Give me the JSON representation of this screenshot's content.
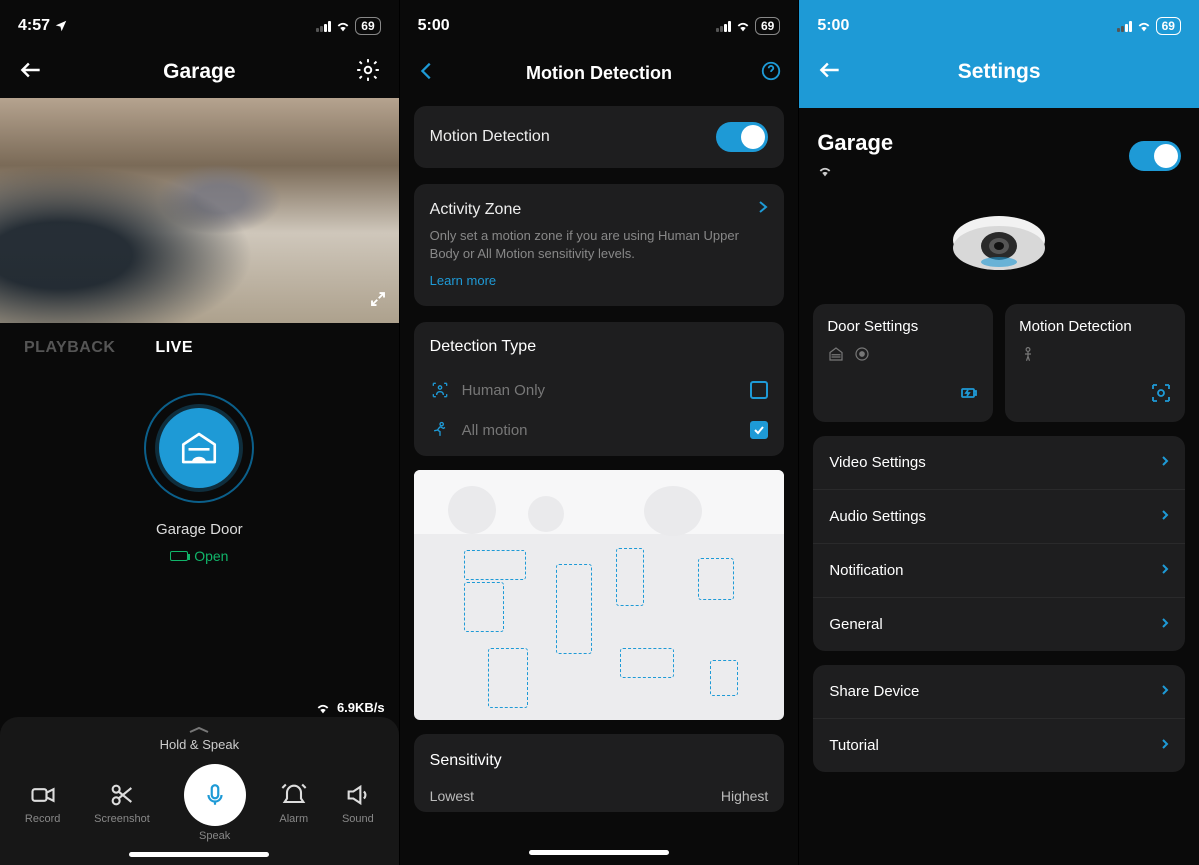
{
  "panel1": {
    "status": {
      "time": "4:57",
      "location_arrow": true,
      "battery": "69"
    },
    "nav": {
      "title": "Garage"
    },
    "tabs": {
      "playback": "PLAYBACK",
      "live": "LIVE"
    },
    "device_label": "Garage Door",
    "door_status": "Open",
    "speed": "6.9KB/s",
    "drawer": {
      "hold_speak": "Hold & Speak",
      "record": "Record",
      "screenshot": "Screenshot",
      "speak": "Speak",
      "alarm": "Alarm",
      "sound": "Sound"
    }
  },
  "panel2": {
    "status": {
      "time": "5:00",
      "battery": "69"
    },
    "nav": {
      "title": "Motion Detection"
    },
    "motion_label": "Motion Detection",
    "zone": {
      "title": "Activity Zone",
      "desc": "Only set a motion zone if you are using Human Upper Body or All Motion sensitivity levels.",
      "learn_more": "Learn more"
    },
    "detection": {
      "title": "Detection Type",
      "human_only": "Human Only",
      "all_motion": "All motion"
    },
    "sensitivity": {
      "title": "Sensitivity",
      "low": "Lowest",
      "high": "Highest"
    }
  },
  "panel3": {
    "status": {
      "time": "5:00",
      "battery": "69"
    },
    "nav": {
      "title": "Settings"
    },
    "device_name": "Garage",
    "tiles": {
      "door": "Door Settings",
      "motion": "Motion Detection"
    },
    "list1": {
      "video": "Video Settings",
      "audio": "Audio Settings",
      "notif": "Notification",
      "general": "General"
    },
    "list2": {
      "share": "Share Device",
      "tutorial": "Tutorial"
    }
  }
}
